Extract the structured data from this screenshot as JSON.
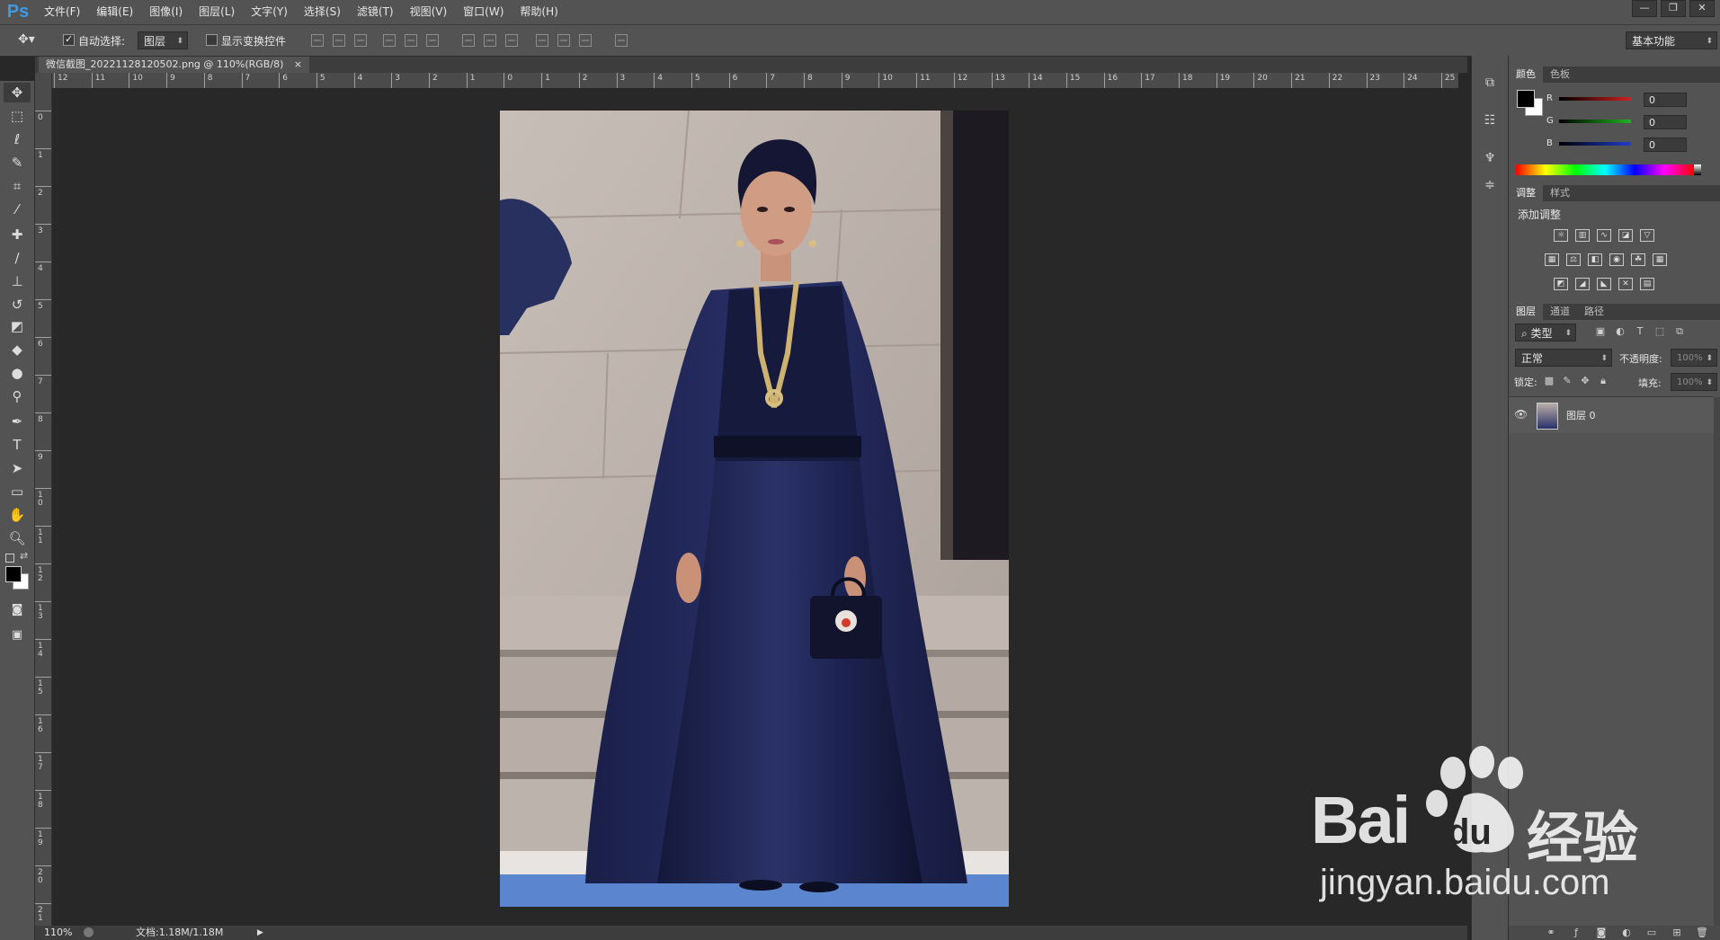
{
  "app": {
    "logo": "Ps"
  },
  "menu": [
    "文件(F)",
    "编辑(E)",
    "图像(I)",
    "图层(L)",
    "文字(Y)",
    "选择(S)",
    "滤镜(T)",
    "视图(V)",
    "窗口(W)",
    "帮助(H)"
  ],
  "window_controls": [
    "—",
    "❐",
    "✕"
  ],
  "options_bar": {
    "auto_select_label": "自动选择:",
    "auto_select_target": "图层",
    "show_transform_label": "显示变换控件",
    "workspace": "基本功能"
  },
  "document": {
    "tab_title": "微信截图_20221128120502.png @ 110%(RGB/8)",
    "close_glyph": "×"
  },
  "ruler": {
    "h_labels": [
      "12",
      "11",
      "10",
      "9",
      "8",
      "7",
      "6",
      "5",
      "4",
      "3",
      "2",
      "1",
      "0",
      "1",
      "2",
      "3",
      "4",
      "5",
      "6",
      "7",
      "8",
      "9",
      "10",
      "11",
      "12",
      "13",
      "14",
      "15",
      "16",
      "17",
      "18",
      "19",
      "20",
      "21",
      "22",
      "23",
      "24",
      "25"
    ],
    "v_labels": [
      "0",
      "1",
      "2",
      "3",
      "4",
      "5",
      "6",
      "7",
      "8",
      "9",
      "10",
      "11",
      "12",
      "13",
      "14",
      "15",
      "16",
      "17",
      "18",
      "19",
      "20",
      "21"
    ]
  },
  "status": {
    "zoom": "110%",
    "doc_size": "文档:1.18M/1.18M"
  },
  "color_panel": {
    "tabs": [
      "颜色",
      "色板"
    ],
    "channels": [
      {
        "label": "R",
        "value": "0",
        "color": "#d21e1e"
      },
      {
        "label": "G",
        "value": "0",
        "color": "#1eb41e"
      },
      {
        "label": "B",
        "value": "0",
        "color": "#1e3cd2"
      }
    ]
  },
  "adjust_panel": {
    "tabs": [
      "调整",
      "样式"
    ],
    "heading": "添加调整"
  },
  "layers_panel": {
    "tabs": [
      "图层",
      "通道",
      "路径"
    ],
    "filter": "类型",
    "blend_mode": "正常",
    "opacity_label": "不透明度:",
    "opacity_value": "100%",
    "lock_label": "锁定:",
    "fill_label": "填充:",
    "fill_value": "100%",
    "layers": [
      {
        "name": "图层 0"
      }
    ]
  },
  "watermark": {
    "brand_text": "Bai",
    "brand_text2": "du",
    "brand_cn": "经验",
    "url": "jingyan.baidu.com"
  }
}
